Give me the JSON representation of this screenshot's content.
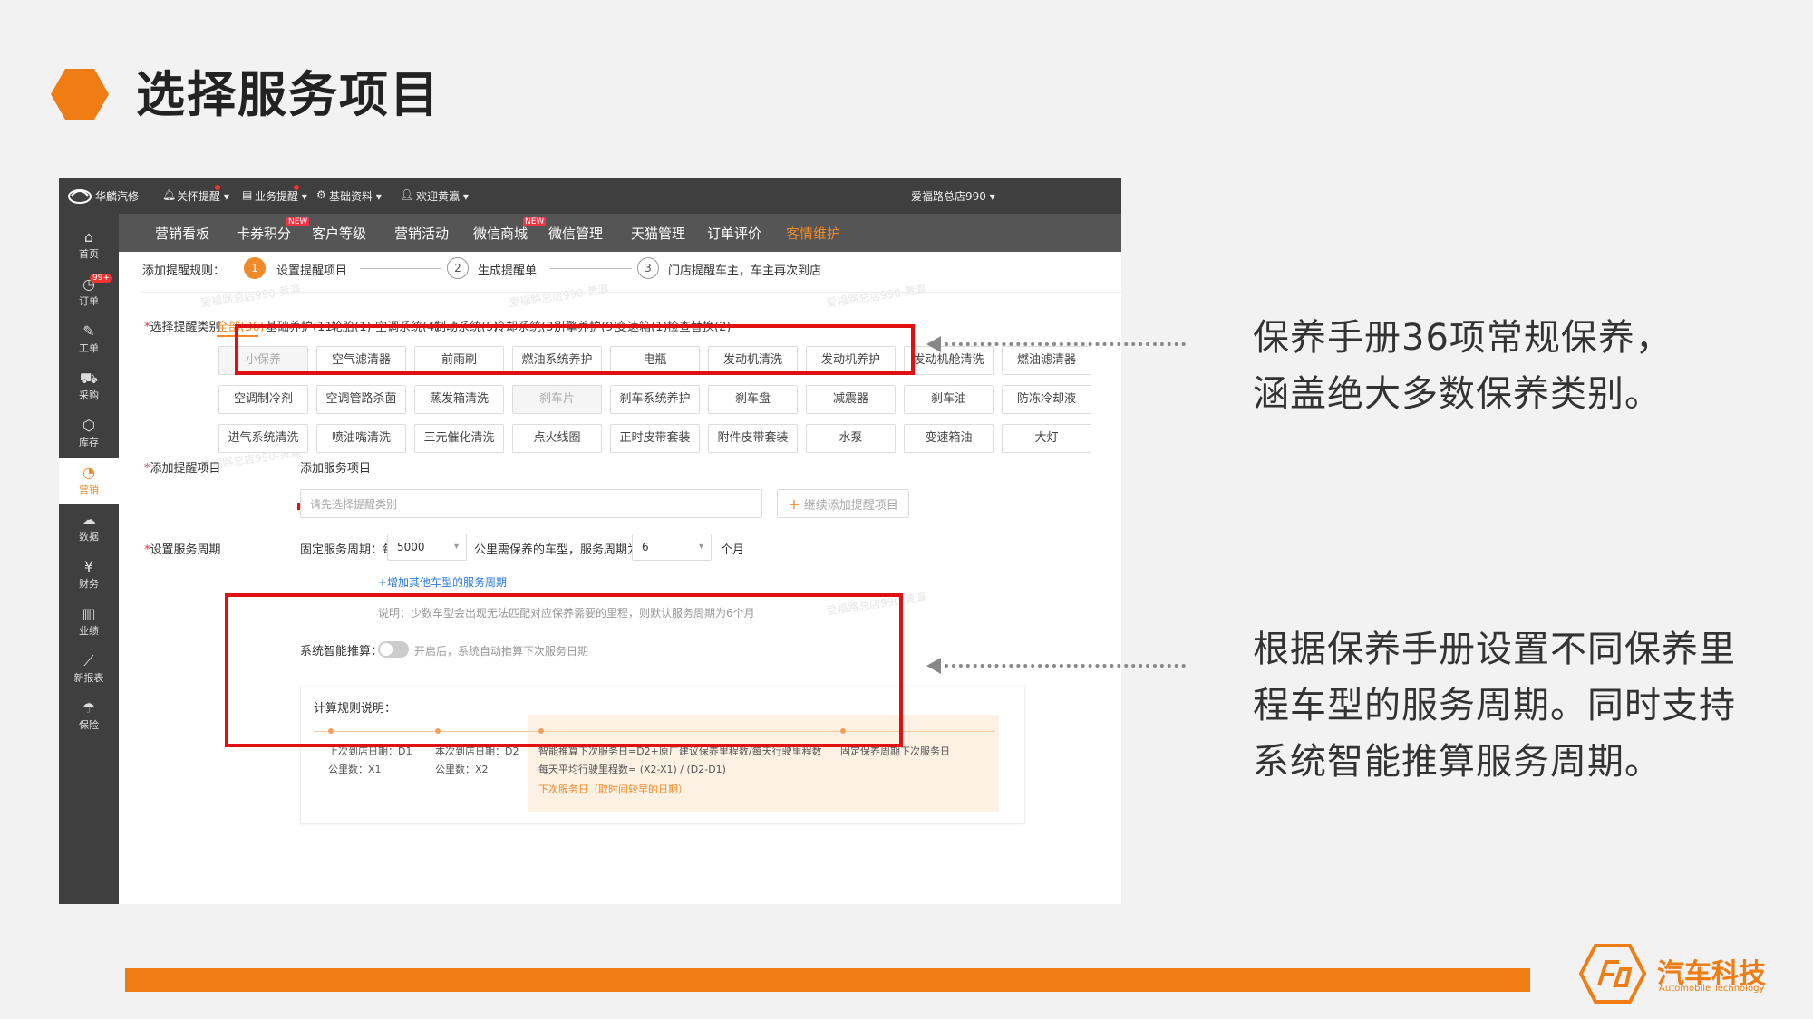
{
  "slide": {
    "title": "选择服务项目",
    "accent": "#f07d14",
    "note1": [
      "保养手册36项常规保养，",
      "涵盖绝大多数保养类别。"
    ],
    "note2": [
      "根据保养手册设置不同保养里",
      "程车型的服务周期。同时支持",
      "系统智能推算服务周期。"
    ],
    "logo": {
      "main": "汽车科技",
      "sub": "Automobile Technology"
    }
  },
  "topbar": {
    "brand": "华麟汽修",
    "items": [
      "关怀提醒",
      "业务提醒",
      "基础资料",
      "欢迎黄瀛"
    ],
    "store": "爱福路总店990"
  },
  "nav": {
    "items": [
      "营销看板",
      "卡券积分",
      "客户等级",
      "营销活动",
      "微信商城",
      "微信管理",
      "天猫管理",
      "订单评价",
      "客情维护"
    ],
    "new_badge": "NEW",
    "active_index": 8
  },
  "sidebar": {
    "items": [
      {
        "label": "首页",
        "icon": "home-icon",
        "glyph": "⌂"
      },
      {
        "label": "订单",
        "icon": "order-icon",
        "glyph": "◷"
      },
      {
        "label": "工单",
        "icon": "wrench-icon",
        "glyph": "✎"
      },
      {
        "label": "采购",
        "icon": "cart-icon",
        "glyph": "⛟"
      },
      {
        "label": "库存",
        "icon": "box-icon",
        "glyph": "⬡"
      },
      {
        "label": "营销",
        "icon": "pie-icon",
        "glyph": "◔"
      },
      {
        "label": "数据",
        "icon": "cloud-icon",
        "glyph": "☁"
      },
      {
        "label": "财务",
        "icon": "yen-icon",
        "glyph": "¥"
      },
      {
        "label": "业绩",
        "icon": "bar-chart-icon",
        "glyph": "▥"
      },
      {
        "label": "新报表",
        "icon": "line-chart-icon",
        "glyph": "⟋"
      },
      {
        "label": "保险",
        "icon": "umbrella-icon",
        "glyph": "☂"
      }
    ],
    "badge": "99+",
    "active_index": 5
  },
  "steps": {
    "label": "添加提醒规则：",
    "items": [
      {
        "num": "1",
        "text": "设置提醒项目"
      },
      {
        "num": "2",
        "text": "生成提醒单"
      },
      {
        "num": "3",
        "text": "门店提醒车主，车主再次到店"
      }
    ]
  },
  "category": {
    "label": "选择提醒类别",
    "tabs": [
      "全部(36)",
      "基础养护(11)",
      "轮胎(1)",
      "空调系统(4)",
      "制动系统(5)",
      "冷却系统(3)",
      "引擎养护(9)",
      "变速箱(1)",
      "检查替换(2)"
    ],
    "active_tab": 0,
    "chips": [
      [
        "小保养",
        "空气滤清器",
        "前雨刷",
        "燃油系统养护",
        "电瓶",
        "发动机清洗",
        "发动机养护",
        "发动机舱清洗",
        "燃油滤清器"
      ],
      [
        "空调制冷剂",
        "空调管路杀菌",
        "蒸发箱清洗",
        "刹车片",
        "刹车系统养护",
        "刹车盘",
        "减震器",
        "刹车油",
        "防冻冷却液"
      ],
      [
        "进气系统清洗",
        "喷油嘴清洗",
        "三元催化清洗",
        "点火线圈",
        "正时皮带套装",
        "附件皮带套装",
        "水泵",
        "变速箱油",
        "大灯"
      ]
    ],
    "disabled": [
      "小保养",
      "刹车片"
    ]
  },
  "add_item": {
    "label": "添加提醒项目",
    "heading": "添加服务项目",
    "placeholder": "请先选择提醒类别",
    "button": "继续添加提醒项目"
  },
  "period": {
    "label": "设置服务周期",
    "prefix": "固定服务周期：每",
    "km_value": "5000",
    "middle": "公里需保养的车型，服务周期为",
    "month_value": "6",
    "suffix": "个月",
    "add_link": "+增加其他车型的服务周期",
    "note": "说明：少数车型会出现无法匹配对应保养需要的里程，则默认服务周期为6个月",
    "smart_label": "系统智能推算：",
    "smart_hint": "开启后，系统自动推算下次服务日期",
    "smart_on": false
  },
  "calc": {
    "title": "计算规则说明：",
    "col1": [
      "上次到店日期：D1",
      "公里数：X1"
    ],
    "col2": [
      "本次到店日期：D2",
      "公里数：X2"
    ],
    "col3": [
      "智能推算下次服务日=D2+原厂建议保养里程数/每天行驶里程数",
      "每天平均行驶里程数= (X2-X1) / (D2-D1)",
      "下次服务日（取时间较早的日期）"
    ],
    "col4": "固定保养周期下次服务日"
  },
  "watermark": "爱福路总店990-黄瀛"
}
